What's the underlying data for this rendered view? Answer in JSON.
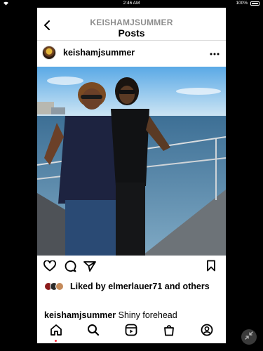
{
  "status_bar": {
    "time": "2:46 AM",
    "battery": "100%"
  },
  "header": {
    "username": "KEISHAMJSUMMER",
    "title": "Posts"
  },
  "post": {
    "author": "keishamjsummer",
    "likes": {
      "prefix": "Liked by ",
      "user": "elmerlauer71",
      "middle": " and ",
      "others": "others"
    },
    "caption": {
      "username": "keishamjsummer",
      "text": "Shiny forehead"
    }
  },
  "icons": {
    "back": "chevron-left-icon",
    "more": "ellipsis-icon",
    "like": "heart-icon",
    "comment": "comment-icon",
    "share": "send-icon",
    "save": "bookmark-icon",
    "home": "home-icon",
    "search": "search-icon",
    "reels": "reels-icon",
    "shop": "shop-icon",
    "profile": "profile-icon",
    "minimize": "minimize-icon"
  },
  "colors": {
    "notification_dot": "#ff3040",
    "secondary_text": "#8e8e8e"
  }
}
